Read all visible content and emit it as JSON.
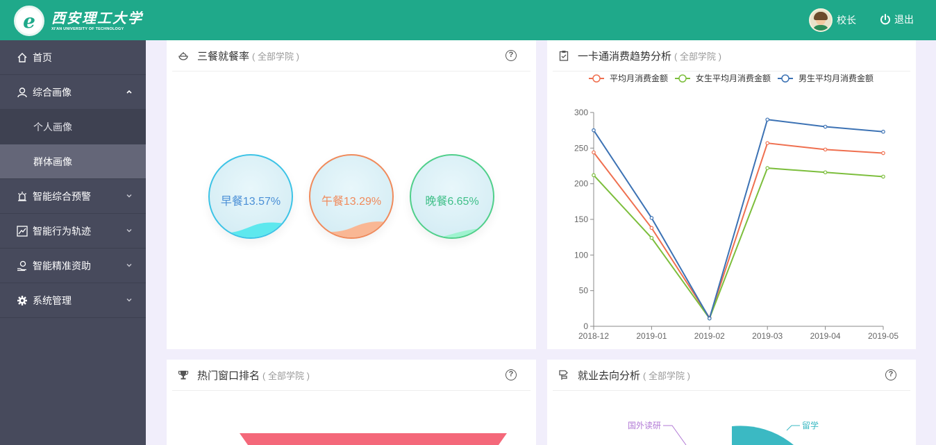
{
  "header": {
    "logo_cn": "西安理工大学",
    "logo_en": "XI'AN UNIVERSITY OF TECHNOLOGY",
    "user_name": "校长",
    "logout_label": "退出",
    "color": "#1fa98a"
  },
  "sidebar": {
    "items": [
      {
        "label": "首页",
        "icon": "home-icon"
      },
      {
        "label": "综合画像",
        "icon": "user-icon",
        "expanded": true
      },
      {
        "label": "个人画像"
      },
      {
        "label": "群体画像",
        "active": true
      },
      {
        "label": "智能综合预警",
        "icon": "alarm-icon"
      },
      {
        "label": "智能行为轨迹",
        "icon": "trend-icon"
      },
      {
        "label": "智能精准资助",
        "icon": "hand-coin-icon"
      },
      {
        "label": "系统管理",
        "icon": "gear-icon"
      }
    ]
  },
  "meals": {
    "title": "三餐就餐率",
    "subtitle": "( 全部学院 )",
    "items": [
      {
        "label": "早餐13.57%",
        "value": 13.57,
        "color": "#3cc3e6",
        "text_color": "#4a8fd6",
        "wave": "#5ee8ee"
      },
      {
        "label": "午餐13.29%",
        "value": 13.29,
        "color": "#f08a5b",
        "text_color": "#f08a5b",
        "wave": "#f9b794"
      },
      {
        "label": "晚餐6.65%",
        "value": 6.65,
        "color": "#4fcf8a",
        "text_color": "#3fbf88",
        "wave": "#9ff3cf"
      }
    ]
  },
  "consumption": {
    "title": "一卡通消费趋势分析",
    "subtitle": "( 全部学院 )"
  },
  "chart_data": {
    "type": "line",
    "x": [
      "2018-12",
      "2019-01",
      "2019-02",
      "2019-03",
      "2019-04",
      "2019-05"
    ],
    "ylim": [
      0,
      300
    ],
    "yticks": [
      "0",
      "50",
      "100",
      "150",
      "200",
      "250",
      "300"
    ],
    "grid": false,
    "legend": "top",
    "series": [
      {
        "name": "平均月消费金额",
        "color": "#ef6f4f",
        "values": [
          244,
          138,
          12,
          257,
          248,
          243
        ]
      },
      {
        "name": "女生平均月消费金额",
        "color": "#7cbe3c",
        "values": [
          212,
          124,
          11,
          222,
          216,
          210
        ]
      },
      {
        "name": "男生平均月消费金额",
        "color": "#3c72b4",
        "values": [
          275,
          152,
          11,
          290,
          280,
          273
        ]
      }
    ]
  },
  "windows": {
    "title": "热门窗口排名",
    "subtitle": "( 全部学院 )",
    "funnel_color": "#f4687a"
  },
  "employment": {
    "title": "就业去向分析",
    "subtitle": "( 全部学院 )",
    "labels": {
      "abroad_study": "国外读研",
      "study_abroad": "留学"
    },
    "colors": {
      "abroad_study": "#b27ad6",
      "study_abroad": "#3bb9c3"
    }
  }
}
